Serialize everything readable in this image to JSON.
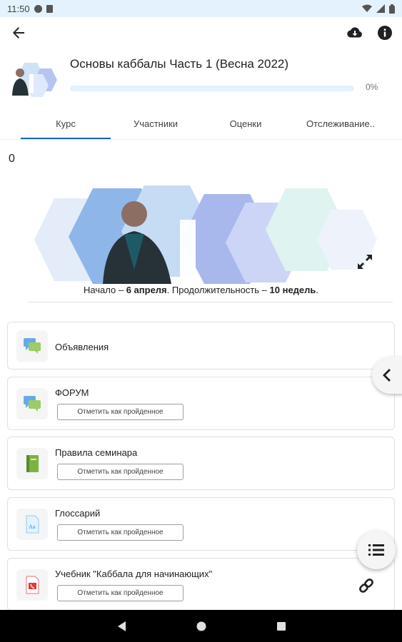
{
  "status_bar": {
    "time": "11:50",
    "icons": [
      "app-icon",
      "sim-icon",
      "wifi-icon",
      "signal-icon",
      "battery-icon"
    ]
  },
  "appbar": {
    "icons": [
      "back-arrow-icon",
      "cloud-download-icon",
      "info-icon"
    ]
  },
  "course": {
    "title": "Основы каббалы Часть 1 (Весна 2022)",
    "progress_text": "0%",
    "progress_value": 0
  },
  "tabs": [
    {
      "label": "Курс",
      "active": true
    },
    {
      "label": "Участники",
      "active": false
    },
    {
      "label": "Оценки",
      "active": false
    },
    {
      "label": "Отслеживание..",
      "active": false
    }
  ],
  "section": {
    "number": "0",
    "caption": {
      "pre": "Начало – ",
      "start": "6 апреля",
      "mid": ". Продолжительность – ",
      "duration": "10 недель",
      "post": "."
    }
  },
  "activities": [
    {
      "title": "Объявления",
      "icon": "forum-chat-icon",
      "mark_label": ""
    },
    {
      "title": "ФОРУМ",
      "icon": "forum-chat-icon",
      "mark_label": "Отметить как пройденное"
    },
    {
      "title": "Правила семинара",
      "icon": "book-icon",
      "mark_label": "Отметить как пройденное"
    },
    {
      "title": "Глоссарий",
      "icon": "glossary-icon",
      "mark_label": "Отметить как пройденное"
    },
    {
      "title": "Учебник \"Каббала для начинающих\"",
      "icon": "pdf-icon",
      "mark_label": "Отметить как пройденное"
    }
  ],
  "colors": {
    "accent": "#1565c0",
    "status_bar_bg": "#e3f2fd",
    "progress_track": "#e3f2fd"
  }
}
